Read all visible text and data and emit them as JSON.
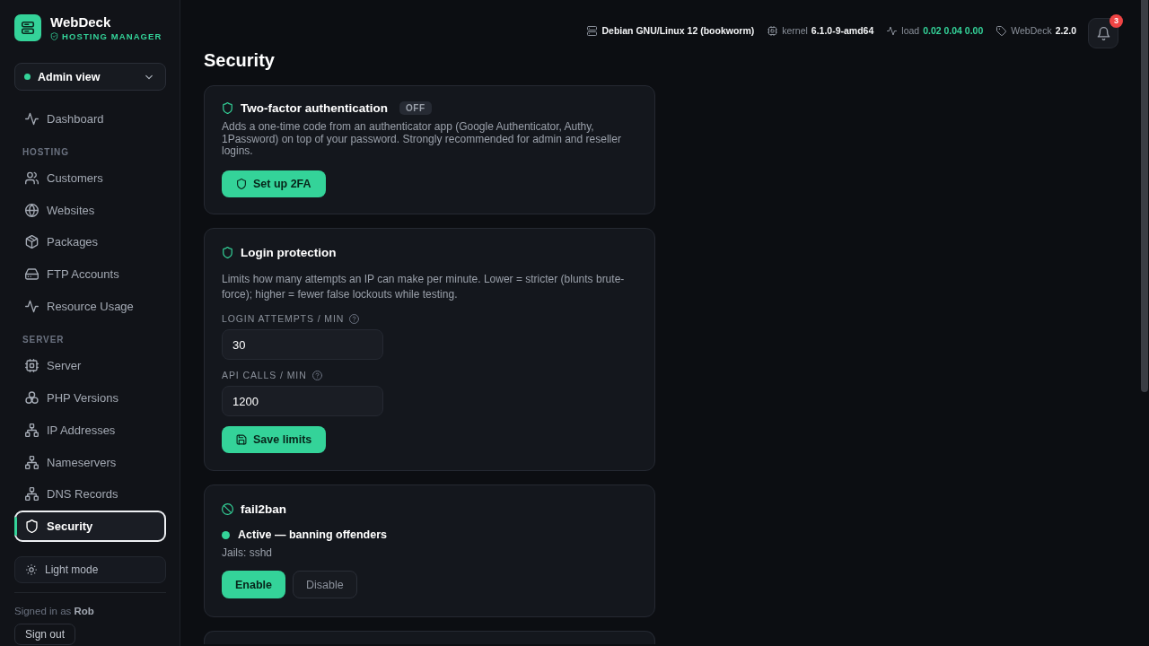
{
  "sidebar": {
    "brand": {
      "name": "WebDeck",
      "tagline": "HOSTING MANAGER"
    },
    "view_switcher": {
      "label": "Admin view"
    },
    "nav": [
      {
        "label": "Dashboard",
        "selected": false
      }
    ],
    "sections": [
      {
        "heading": "HOSTING",
        "items": [
          {
            "label": "Customers",
            "selected": false
          },
          {
            "label": "Websites",
            "selected": false
          },
          {
            "label": "Packages",
            "selected": false
          },
          {
            "label": "FTP Accounts",
            "selected": false
          },
          {
            "label": "Resource Usage",
            "selected": false
          }
        ]
      },
      {
        "heading": "SERVER",
        "items": [
          {
            "label": "Server",
            "selected": false
          },
          {
            "label": "PHP Versions",
            "selected": false
          },
          {
            "label": "IP Addresses",
            "selected": false
          },
          {
            "label": "Nameservers",
            "selected": false
          },
          {
            "label": "DNS Records",
            "selected": false
          },
          {
            "label": "Security",
            "selected": true
          }
        ]
      }
    ],
    "theme_toggle": "Light mode",
    "signed_in": "Signed in as **Rob**",
    "sign_out": "Sign out"
  },
  "system_info": [
    {
      "kind": "os",
      "value": "Debian GNU/Linux 12 (bookworm)",
      "color": "#f3f4f6"
    },
    {
      "kind": "kernel",
      "label": "kernel",
      "value": "6.1.0-9-amd64",
      "color": "#f3f4f6"
    },
    {
      "kind": "load",
      "label": "load",
      "value": "0.02 0.04 0.00",
      "color": "#34d399"
    },
    {
      "kind": "version",
      "label": "WebDeck",
      "value": "2.2.0",
      "color": "#f3f4f6"
    }
  ],
  "notifications": {
    "count": "3"
  },
  "page_title": "Security",
  "cards": [
    {
      "kind": "two_factor",
      "title": "Two-factor authentication",
      "badge": "OFF",
      "description": "Adds a one-time code from an authenticator app (Google Authenticator, Authy, 1Password) on top of your password. Strongly recommended for admin and reseller logins.",
      "button": "Set up 2FA"
    },
    {
      "kind": "rate_limits",
      "title": "Login protection",
      "description": "Limits how many attempts an IP can make per minute. Lower = stricter (blunts brute-force); higher = fewer false lockouts while testing.",
      "fields": [
        {
          "label": "LOGIN ATTEMPTS / MIN",
          "value": "30"
        },
        {
          "label": "API CALLS / MIN",
          "value": "1200"
        }
      ],
      "button": "Save limits"
    },
    {
      "kind": "fail2ban",
      "title": "fail2ban",
      "status": {
        "label": "Active — banning offenders",
        "active": true
      },
      "detail": "Jails: sshd",
      "buttons": [
        {
          "kind": "primary",
          "label": "Enable"
        },
        {
          "kind": "secondary",
          "label": "Disable"
        }
      ]
    }
  ]
}
